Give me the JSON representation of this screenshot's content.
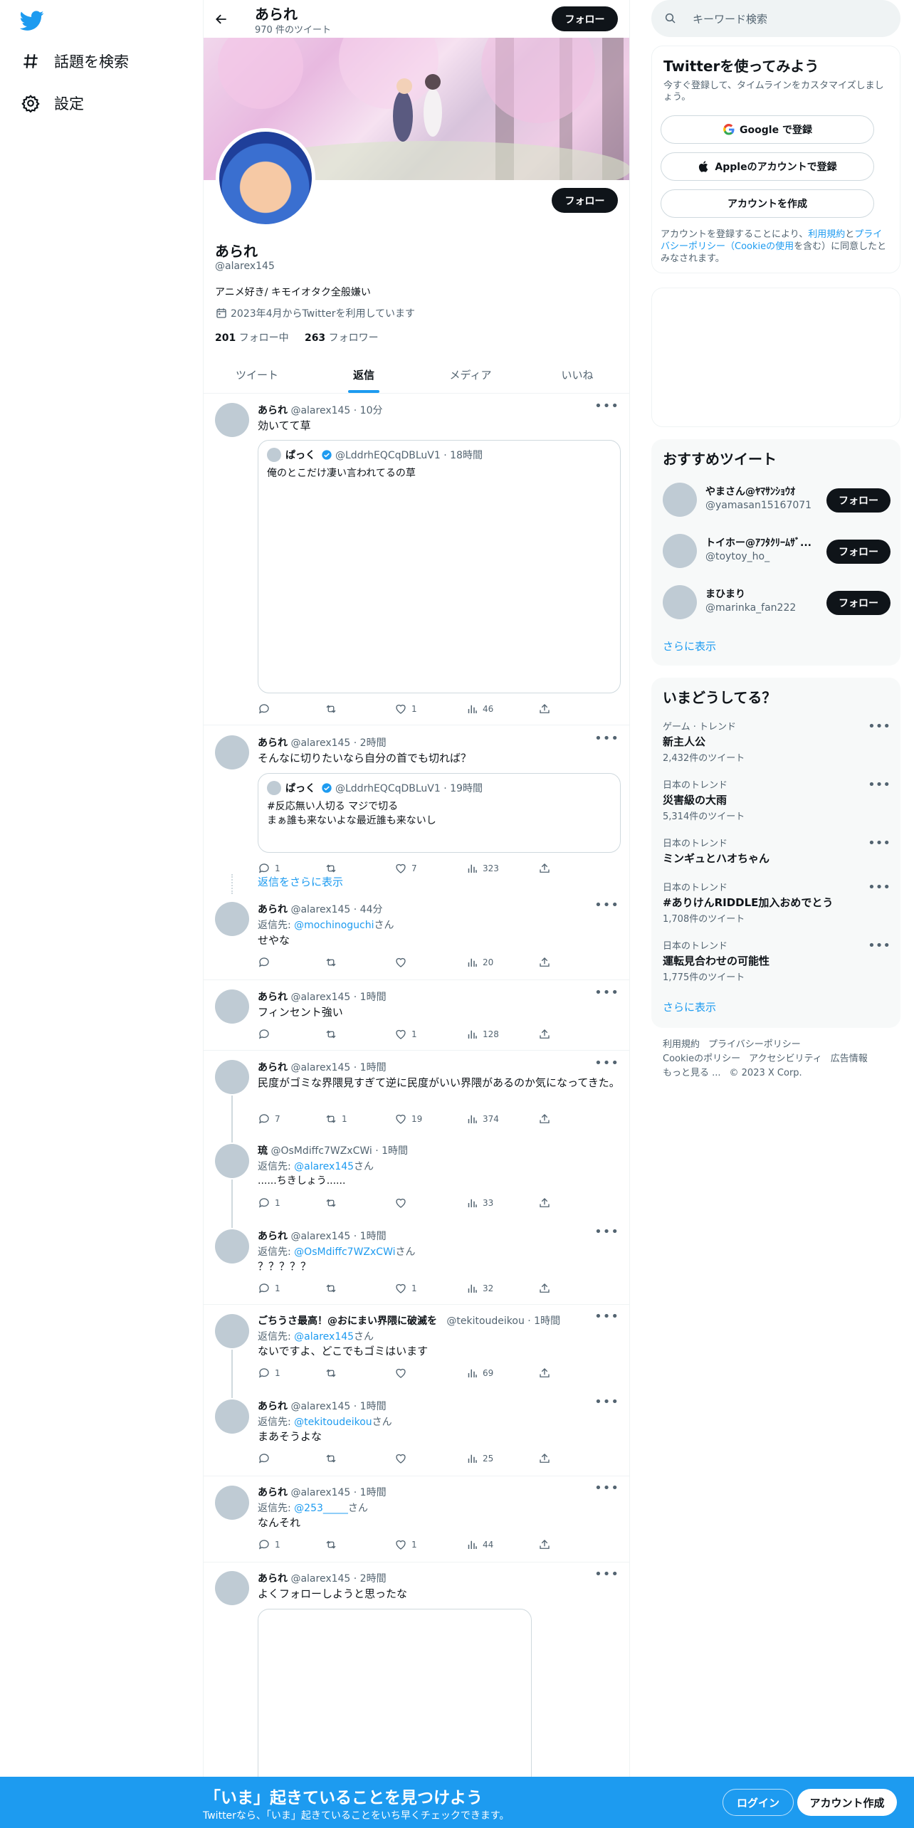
{
  "nav": {
    "explore": "話題を検索",
    "settings": "設定"
  },
  "profile": {
    "name": "あられ",
    "tweet_count": "970 件のツイート",
    "follow_label": "フォロー",
    "handle": "@alarex145",
    "bio": "アニメ好き/ キモイオタク全般嫌い",
    "joined": "2023年4月からTwitterを利用しています",
    "following_count": "201",
    "following_label": "フォロー中",
    "followers_count": "263",
    "followers_label": "フォロワー"
  },
  "tabs": [
    "ツイート",
    "返信",
    "メディア",
    "いいね"
  ],
  "tweets": [
    {
      "name": "あられ",
      "meta": "@alarex145 · 10分",
      "text": "効いてて草",
      "quote": {
        "name": "ぱっく",
        "meta": "@LddrhEQCqDBLuV1 · 18時間",
        "text": "俺のとこだけ凄い言われてるの草"
      },
      "replies": "",
      "retweets": "",
      "likes": "1",
      "views": "46"
    },
    {
      "name": "あられ",
      "meta": "@alarex145 · 2時間",
      "text": "そんなに切りたいなら自分の首でも切れば？",
      "quote": {
        "name": "ぱっく",
        "meta": "@LddrhEQCqDBLuV1 · 19時間",
        "text1": "#反応無い人切る マジで切る",
        "text2": "まぁ誰も来ないよな最近誰も来ないし"
      },
      "replies": "1",
      "retweets": "",
      "likes": "7",
      "views": "323"
    },
    {
      "show_more": "返信をさらに表示"
    },
    {
      "name": "あられ",
      "meta": "@alarex145 · 44分",
      "reply_prefix": "返信先: ",
      "reply_to": "@mochinoguchi",
      "reply_suffix": "さん",
      "text": "せやな",
      "replies": "",
      "retweets": "",
      "likes": "",
      "views": "20"
    },
    {
      "name": "あられ",
      "meta": "@alarex145 · 1時間",
      "text": "フィンセント強い",
      "replies": "",
      "retweets": "",
      "likes": "1",
      "views": "128"
    },
    {
      "name": "あられ",
      "meta": "@alarex145 · 1時間",
      "text": "民度がゴミな界隈見すぎて逆に民度がいい界隈があるのか気になってきた。",
      "replies": "7",
      "retweets": "1",
      "likes": "19",
      "views": "374"
    },
    {
      "name": "琉",
      "meta": "@OsMdiffc7WZxCWi · 1時間",
      "reply_prefix": "返信先: ",
      "reply_to": "@alarex145",
      "reply_suffix": "さん",
      "text": "......ちきしょう......",
      "replies": "1",
      "retweets": "",
      "likes": "",
      "views": "33"
    },
    {
      "name": "あられ",
      "meta": "@alarex145 · 1時間",
      "reply_prefix": "返信先: ",
      "reply_to": "@OsMdiffc7WZxCWi",
      "reply_suffix": "さん",
      "text": "？？？？？",
      "replies": "1",
      "retweets": "",
      "likes": "1",
      "views": "32"
    },
    {
      "name": "ごちうさ最高！@おにまい界隈に破滅を",
      "meta": "@tekitoudeikou · 1時間",
      "reply_prefix": "返信先: ",
      "reply_to": "@alarex145",
      "reply_suffix": "さん",
      "text": "ないですよ、どこでもゴミはいます",
      "replies": "1",
      "retweets": "",
      "likes": "",
      "views": "69"
    },
    {
      "name": "あられ",
      "meta": "@alarex145 · 1時間",
      "reply_prefix": "返信先: ",
      "reply_to": "@tekitoudeikou",
      "reply_suffix": "さん",
      "text": "まあそうよな",
      "replies": "",
      "retweets": "",
      "likes": "",
      "views": "25"
    },
    {
      "name": "あられ",
      "meta": "@alarex145 · 1時間",
      "reply_prefix": "返信先: ",
      "reply_to": "@253_____",
      "reply_suffix": "さん",
      "text": "なんそれ",
      "replies": "1",
      "retweets": "",
      "likes": "1",
      "views": "44"
    },
    {
      "name": "あられ",
      "meta": "@alarex145 · 2時間",
      "text": "よくフォローしようと思ったな"
    }
  ],
  "search": {
    "placeholder": "キーワード検索"
  },
  "signup": {
    "title": "Twitterを使ってみよう",
    "desc": "今すぐ登録して、タイムラインをカスタマイズしましょう。",
    "google": "Google で登録",
    "apple": "Appleのアカウントで登録",
    "create": "アカウントを作成",
    "terms_1": "アカウントを登録することにより、",
    "terms_link1": "利用規約",
    "terms_2": "と",
    "terms_link2": "プライバシーポリシー（Cookieの使用",
    "terms_3": "を含む）に同意したとみなされます。"
  },
  "recommended": {
    "title": "おすすめツイート",
    "users": [
      {
        "name": "やまさん@ﾔﾏｻﾝｼｮｳｵ",
        "handle": "@yamasan15167071"
      },
      {
        "name": "トイホー@ｱﾌﾀｸﾘｰﾑｻﾞ...",
        "handle": "@toytoy_ho_"
      },
      {
        "name": "まひまり",
        "handle": "@marinka_fan222"
      }
    ],
    "follow": "フォロー",
    "more": "さらに表示"
  },
  "trends": {
    "title": "いまどうしてる？",
    "items": [
      {
        "meta": "ゲーム · トレンド",
        "title": "新主人公",
        "count": "2,432件のツイート"
      },
      {
        "meta": "日本のトレンド",
        "title": "災害級の大雨",
        "count": "5,314件のツイート"
      },
      {
        "meta": "日本のトレンド",
        "title": "ミンギュとハオちゃん",
        "count": ""
      },
      {
        "meta": "日本のトレンド",
        "title": "#ありけんRIDDLE加入おめでとう",
        "count": "1,708件のツイート"
      },
      {
        "meta": "日本のトレンド",
        "title": "運転見合わせの可能性",
        "count": "1,775件のツイート"
      }
    ],
    "more": "さらに表示"
  },
  "footer": {
    "l1a": "利用規約",
    "l1b": "プライバシーポリシー",
    "l2a": "Cookieのポリシー",
    "l2b": "アクセシビリティ",
    "l2c": "広告情報",
    "l3a": "もっと見る ...",
    "l3b": "© 2023 X Corp."
  },
  "bottom": {
    "title": "「いま」起きていることを見つけよう",
    "sub": "Twitterなら、「いま」起きていることをいち早くチェックできます。",
    "login": "ログイン",
    "signup": "アカウント作成"
  },
  "colors": {
    "accent": "#1d9bf0",
    "dark": "#0f1419",
    "muted": "#536471"
  }
}
